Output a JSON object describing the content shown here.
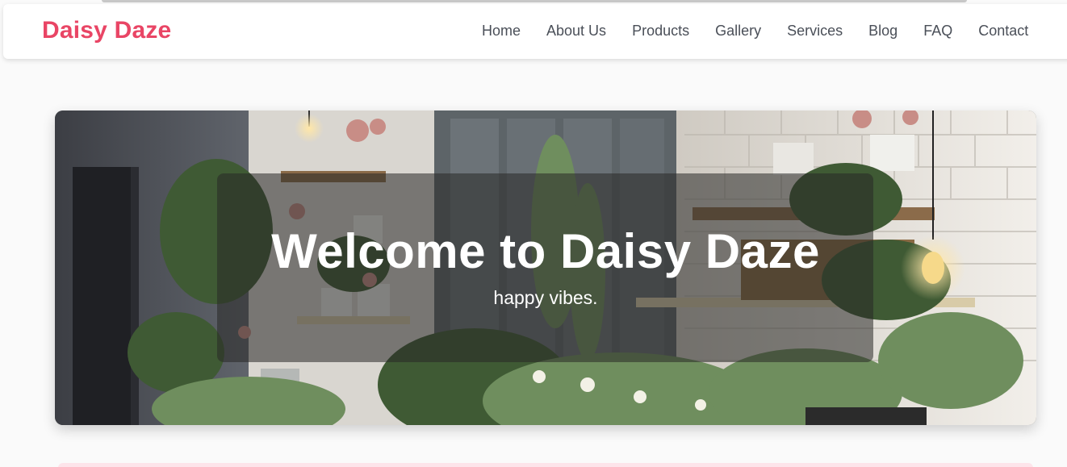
{
  "brand": {
    "name": "Daisy Daze",
    "color": "#e94565"
  },
  "nav": {
    "items": [
      {
        "label": "Home"
      },
      {
        "label": "About Us"
      },
      {
        "label": "Products"
      },
      {
        "label": "Gallery"
      },
      {
        "label": "Services"
      },
      {
        "label": "Blog"
      },
      {
        "label": "FAQ"
      },
      {
        "label": "Contact"
      }
    ]
  },
  "hero": {
    "title": "Welcome to Daisy Daze",
    "subtitle": "happy vibes.",
    "image": "flower-shop-interior"
  }
}
